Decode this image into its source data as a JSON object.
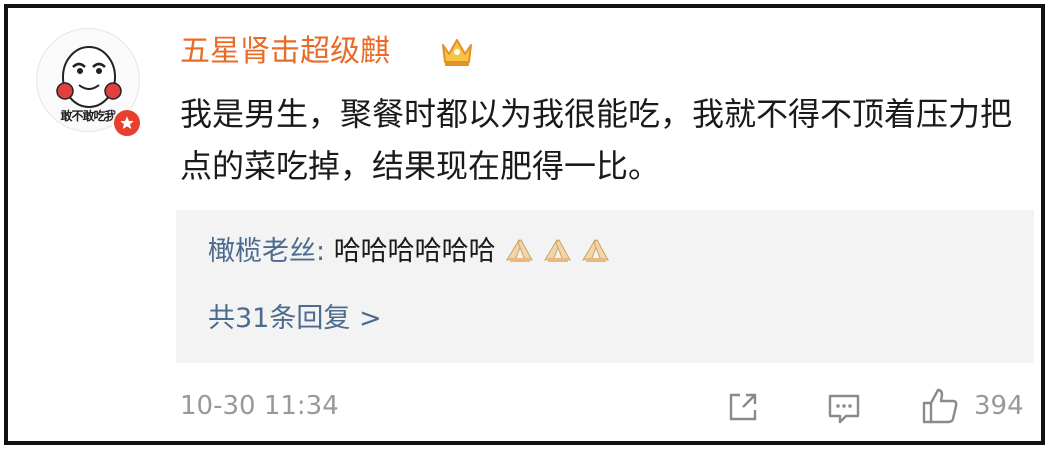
{
  "post": {
    "avatar_caption": "敢不敢吃我",
    "username": "五星肾击超级麒",
    "comment_text": "我是男生，聚餐时都以为我很能吃，我就不得不顶着压力把点的菜吃掉，结果现在肥得一比。",
    "reply": {
      "author": "橄榄老丝",
      "separator": ": ",
      "text": "哈哈哈哈哈哈"
    },
    "more_replies": "共31条回复 >",
    "timestamp": "10-30 11:34",
    "like_count": "394"
  },
  "colors": {
    "username": "#e86b28",
    "link": "#4d6b8f",
    "muted": "#999999",
    "reply_bg": "#f3f3f3"
  },
  "icons": [
    "vip-star-icon",
    "crown-icon",
    "pray-hands-emoji",
    "share-icon",
    "comment-icon",
    "like-icon"
  ]
}
